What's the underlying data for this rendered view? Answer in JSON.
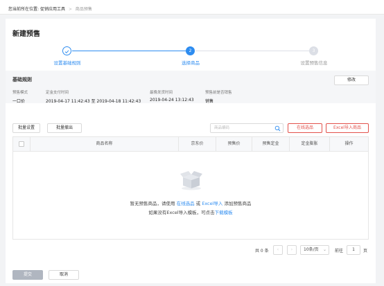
{
  "breadcrumb": {
    "prefix": "您当前所在位置:",
    "items": [
      "促销应用工具",
      "商品预售"
    ],
    "separator": ">"
  },
  "page_title": "新建预售",
  "steps": [
    {
      "label": "设置基础规则",
      "state": "done"
    },
    {
      "label": "选择商品",
      "number": "2",
      "state": "active"
    },
    {
      "label": "设置预售信息",
      "number": "3",
      "state": "pending"
    }
  ],
  "basic_rules": {
    "title": "基础规则",
    "edit_label": "修改",
    "fields": [
      {
        "label": "预售模式",
        "value": "一口价"
      },
      {
        "label": "定金支付时间",
        "value": "2019-04-17 11:42:43 至 2019-04-18 11:42:43"
      },
      {
        "label": "最晚发货时间",
        "value": "2019-04-24 13:12:43"
      },
      {
        "label": "预售前是否销售",
        "value": "销售"
      }
    ]
  },
  "toolbar": {
    "batch_set": "批量设置",
    "batch_remove": "批量撤出",
    "search_placeholder": "商品编码",
    "online_select": "在线选品",
    "excel_import": "Excel导入商品"
  },
  "table": {
    "columns": [
      "商品名称",
      "京东价",
      "预售价",
      "预售定金",
      "定金膨胀",
      "操作"
    ],
    "rows": [],
    "empty": {
      "line1_prefix": "暂无预售商品，请使用",
      "link1": "在线选品",
      "or": "或",
      "link2": "Excel导入",
      "line1_suffix": "添加预售商品",
      "line2_prefix": "如果没有Excel导入模板，可点击",
      "link3": "下载模板"
    }
  },
  "pagination": {
    "total": "共 0 条",
    "page_size": "10条/页",
    "goto_label": "前往",
    "page": "1",
    "page_unit": "页"
  },
  "footer": {
    "submit": "提交",
    "cancel": "取消"
  },
  "colors": {
    "accent": "#2d8cf0",
    "danger": "#e2504a",
    "pending": "#c5c8ce"
  }
}
